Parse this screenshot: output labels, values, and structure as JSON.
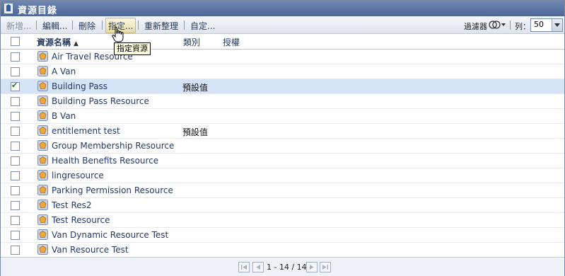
{
  "title": "資源目錄",
  "toolbar": {
    "new_label": "新增...",
    "edit_label": "編輯...",
    "delete_label": "刪除",
    "assign_label": "指定...",
    "refresh_label": "重新整理",
    "customize_label": "自定...",
    "filter_label": "過濾器",
    "rows_label": "列：",
    "rows_value": "50"
  },
  "tooltip": "指定資源",
  "columns": {
    "name": "資源名稱",
    "category": "類別",
    "authorization": "授權"
  },
  "rows": [
    {
      "name": "Air Travel Resource",
      "category": "",
      "checked": false
    },
    {
      "name": "A Van",
      "category": "",
      "checked": false
    },
    {
      "name": "Building Pass",
      "category": "預設值",
      "checked": true
    },
    {
      "name": "Building Pass Resource",
      "category": "",
      "checked": false
    },
    {
      "name": "B Van",
      "category": "",
      "checked": false
    },
    {
      "name": "entitlement test",
      "category": "預設值",
      "checked": false
    },
    {
      "name": "Group Membership Resource",
      "category": "",
      "checked": false
    },
    {
      "name": "Health Benefits Resource",
      "category": "",
      "checked": false
    },
    {
      "name": "lingresource",
      "category": "",
      "checked": false
    },
    {
      "name": "Parking Permission Resource",
      "category": "",
      "checked": false
    },
    {
      "name": "Test Res2",
      "category": "",
      "checked": false
    },
    {
      "name": "Test Resource",
      "category": "",
      "checked": false
    },
    {
      "name": "Van Dynamic Resource Test",
      "category": "",
      "checked": false
    },
    {
      "name": "Van Resource Test",
      "category": "",
      "checked": false
    }
  ],
  "pagination": {
    "text": "1 - 14 / 14"
  },
  "colors": {
    "title_bar": "#5a73a3",
    "selected_row": "#d4e3f6",
    "link_text": "#243a66"
  }
}
